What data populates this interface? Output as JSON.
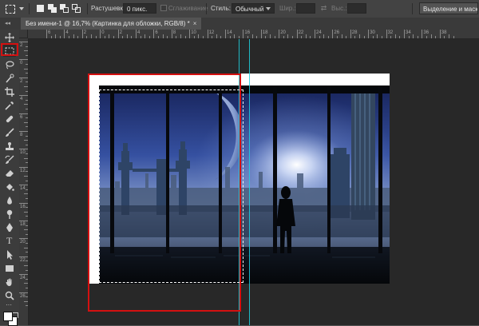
{
  "options_bar": {
    "tool_preset_icon": "rectangular-marquee-icon",
    "selection_modes": [
      "new-selection-icon",
      "add-to-selection-icon",
      "subtract-from-selection-icon",
      "intersect-selection-icon"
    ],
    "feather_label": "Растушевка:",
    "feather_value": "0 пикс.",
    "antialias_label": "Сглаживание",
    "style_label": "Стиль:",
    "style_value": "Обычный",
    "width_label": "Шир.:",
    "height_label": "Выс.:",
    "mask_button_label": "Выделение и маска..."
  },
  "document_tab": {
    "title": "Без имени-1 @ 16,7% (Картинка для обложки, RGB/8) *",
    "close_glyph": "×",
    "collapse_glyph": "◂◂"
  },
  "toolbar": {
    "tools": [
      "move-icon",
      "rectangular-marquee-icon",
      "lasso-icon",
      "quick-selection-icon",
      "crop-icon",
      "eyedropper-icon",
      "healing-brush-icon",
      "brush-icon",
      "clone-stamp-icon",
      "history-brush-icon",
      "eraser-icon",
      "paint-bucket-icon",
      "blur-icon",
      "dodge-icon",
      "pen-icon",
      "type-icon",
      "path-selection-icon",
      "rectangle-icon",
      "hand-icon",
      "zoom-icon",
      "more-tools-icon",
      "swap-colors-icon",
      "foreground-background-icon"
    ],
    "type_glyph": "T",
    "more_glyph": "···",
    "active_tool": "rectangular-marquee-icon",
    "highlight_color": "#d41010"
  },
  "ruler": {
    "horizontal_labels": [
      "6",
      "4",
      "2",
      "0",
      "2",
      "4",
      "6",
      "8",
      "10",
      "12",
      "14",
      "16",
      "18",
      "20",
      "22",
      "24",
      "26",
      "28",
      "30",
      "32",
      "34",
      "36",
      "38"
    ],
    "vertical_labels": [
      "2",
      "0",
      "2",
      "4",
      "6",
      "8",
      "10",
      "12",
      "14",
      "16",
      "18",
      "20",
      "22",
      "24",
      "26"
    ]
  },
  "colors": {
    "guide": "#1fd1e0",
    "selection_outline": "#ffffff",
    "annotation": "#d41010"
  }
}
